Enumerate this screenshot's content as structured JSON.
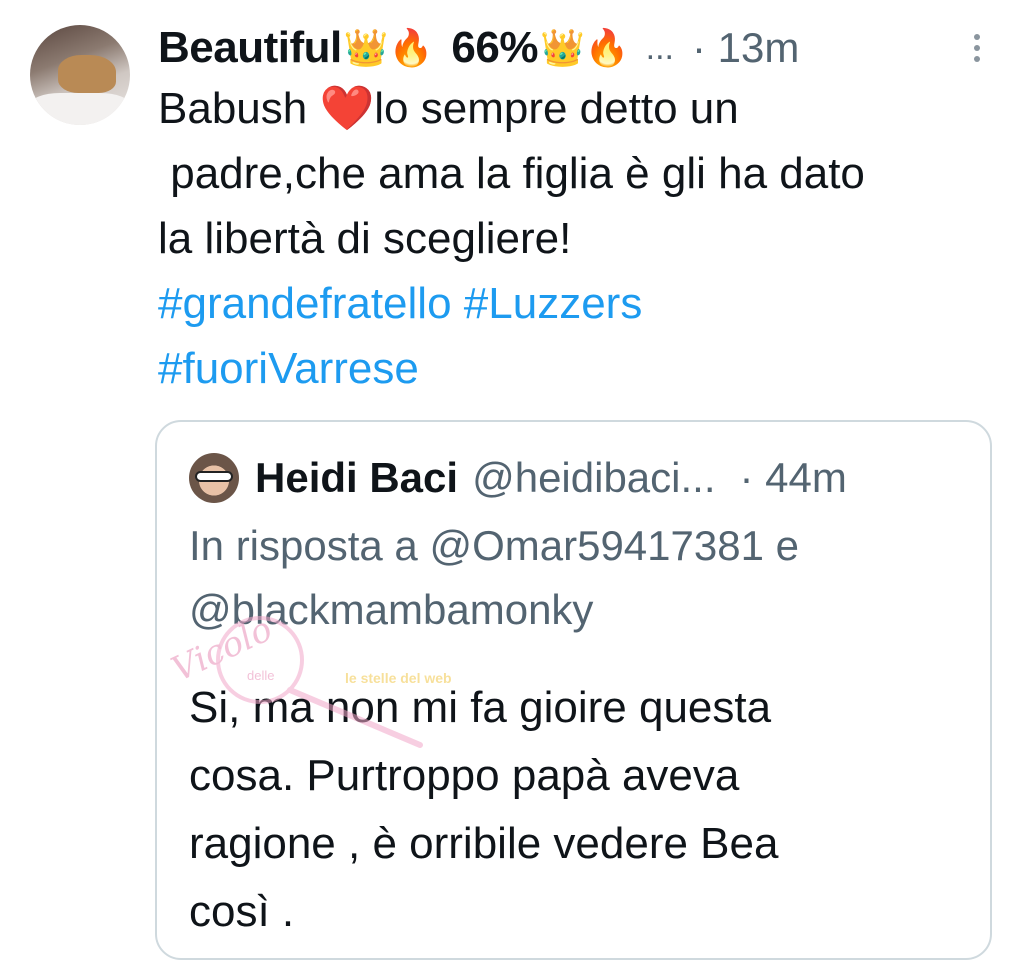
{
  "tweet": {
    "author_name": "Beautiful",
    "header_emoji_1": "👑🔥",
    "header_percent": "66%",
    "header_emoji_2": "👑🔥",
    "truncation": "...",
    "time": "· 13m",
    "avatar_icon": "profile-photo-dog",
    "more_icon": "vertical-ellipsis-icon",
    "body": {
      "line1_prefix": "Babush ",
      "line1_heart": "❤️",
      "line1_suffix": "lo sempre detto un",
      "line2": " padre,che ama la figlia è gli ha dato",
      "line3": "la libertà di scegliere!",
      "hashtags": [
        "#grandefratello",
        "#Luzzers",
        "#fuoriVarrese"
      ]
    }
  },
  "quote": {
    "author_name": "Heidi Baci",
    "handle": "@heidibaci...",
    "time": "· 44m",
    "reply_line1": "In risposta a @Omar59417381 e",
    "reply_line2": "@blackmambamonky",
    "body_lines": [
      "Si, ma non mi fa gioire questa",
      "cosa. Purtroppo papà aveva",
      "ragione , è orribile vedere Bea",
      "così ."
    ]
  },
  "watermark": {
    "text_1": "Vicolo",
    "text_2": "delle",
    "text_3": "le stelle del web"
  },
  "colors": {
    "text": "#0f1419",
    "secondary": "#536471",
    "link": "#1d9bf0",
    "border": "#cfd9de",
    "heart": "#e0182d"
  }
}
